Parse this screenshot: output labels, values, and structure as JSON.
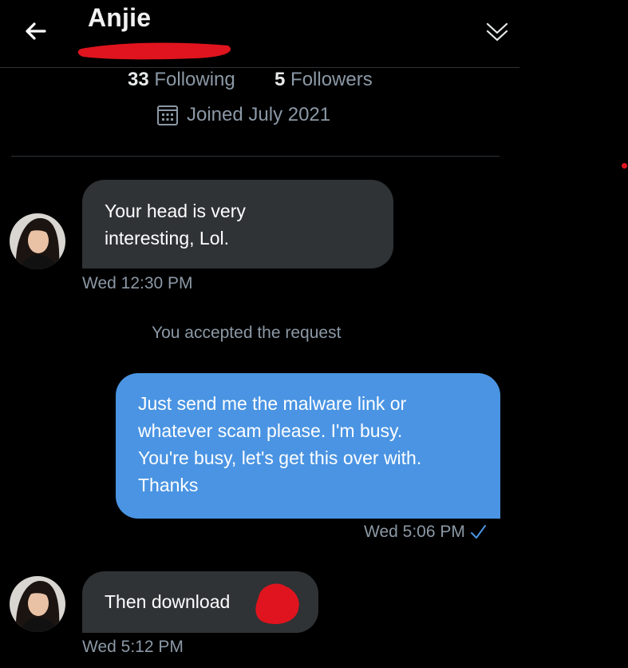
{
  "header": {
    "title": "Anjie",
    "back_icon": "arrow-left-icon",
    "collapse_icon": "chevron-double-down-icon"
  },
  "profile": {
    "following_count": "33",
    "following_label": "Following",
    "followers_count": "5",
    "followers_label": "Followers",
    "joined_icon": "calendar-icon",
    "joined_text": "Joined July 2021"
  },
  "conversation": {
    "messages": [
      {
        "direction": "incoming",
        "text_lines": [
          "Your head is very",
          "interesting, Lol."
        ],
        "time": "Wed 12:30 PM"
      },
      {
        "direction": "system",
        "text": "You accepted the request"
      },
      {
        "direction": "outgoing",
        "text_lines": [
          "Just send me the malware link or",
          "whatever scam please. I'm busy.",
          "You're busy, let's get this over with.",
          "Thanks"
        ],
        "time": "Wed 5:06 PM",
        "status_icon": "check-icon"
      },
      {
        "direction": "incoming",
        "text": "Then download",
        "time": "Wed 5:12 PM"
      }
    ]
  },
  "colors": {
    "background": "#000000",
    "incoming_bubble": "#2f3336",
    "outgoing_bubble": "#4a94e3",
    "muted_text": "#8b98a5",
    "redaction": "#e0141e"
  }
}
